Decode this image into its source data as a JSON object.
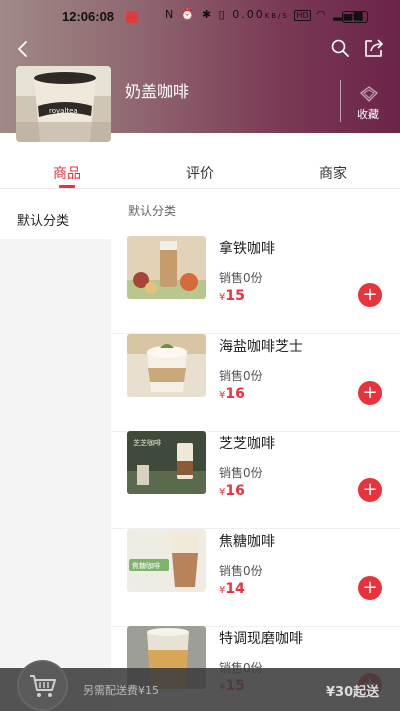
{
  "status_bar": {
    "time": "12:06:08",
    "net_speed": "0.00",
    "net_unit": "KB/S",
    "hd": "HD",
    "battery": "81"
  },
  "store": {
    "name": "奶盖咖啡",
    "favorite_label": "收藏",
    "image_text": "royaltea"
  },
  "tabs": [
    {
      "label": "商品",
      "active": true
    },
    {
      "label": "评价",
      "active": false
    },
    {
      "label": "商家",
      "active": false
    }
  ],
  "sidebar": {
    "items": [
      {
        "label": "默认分类",
        "active": true
      }
    ]
  },
  "category_title": "默认分类",
  "products": [
    {
      "name": "拿铁咖啡",
      "sales": "销售0份",
      "currency": "¥",
      "price": "15",
      "image_color": "#d9c2a5"
    },
    {
      "name": "海盐咖啡芝士",
      "sales": "销售0份",
      "currency": "¥",
      "price": "16",
      "image_color": "#c8b89a"
    },
    {
      "name": "芝芝咖啡",
      "sales": "销售0份",
      "currency": "¥",
      "price": "16",
      "image_color": "#4a5a44",
      "image_text": "芝芝咖啡"
    },
    {
      "name": "焦糖咖啡",
      "sales": "销售0份",
      "currency": "¥",
      "price": "14",
      "image_color": "#e9e6dc",
      "image_text": "焦糖咖啡"
    },
    {
      "name": "特调现磨咖啡",
      "sales": "销售0份",
      "currency": "¥",
      "price": "15",
      "image_color": "#a7a7a0"
    }
  ],
  "bottom_bar": {
    "delivery_fee_text": "另需配送费¥15",
    "min_order_text": "¥30起送"
  },
  "colors": {
    "accent": "#e8323c",
    "header_gradient_end": "#6b2447"
  }
}
